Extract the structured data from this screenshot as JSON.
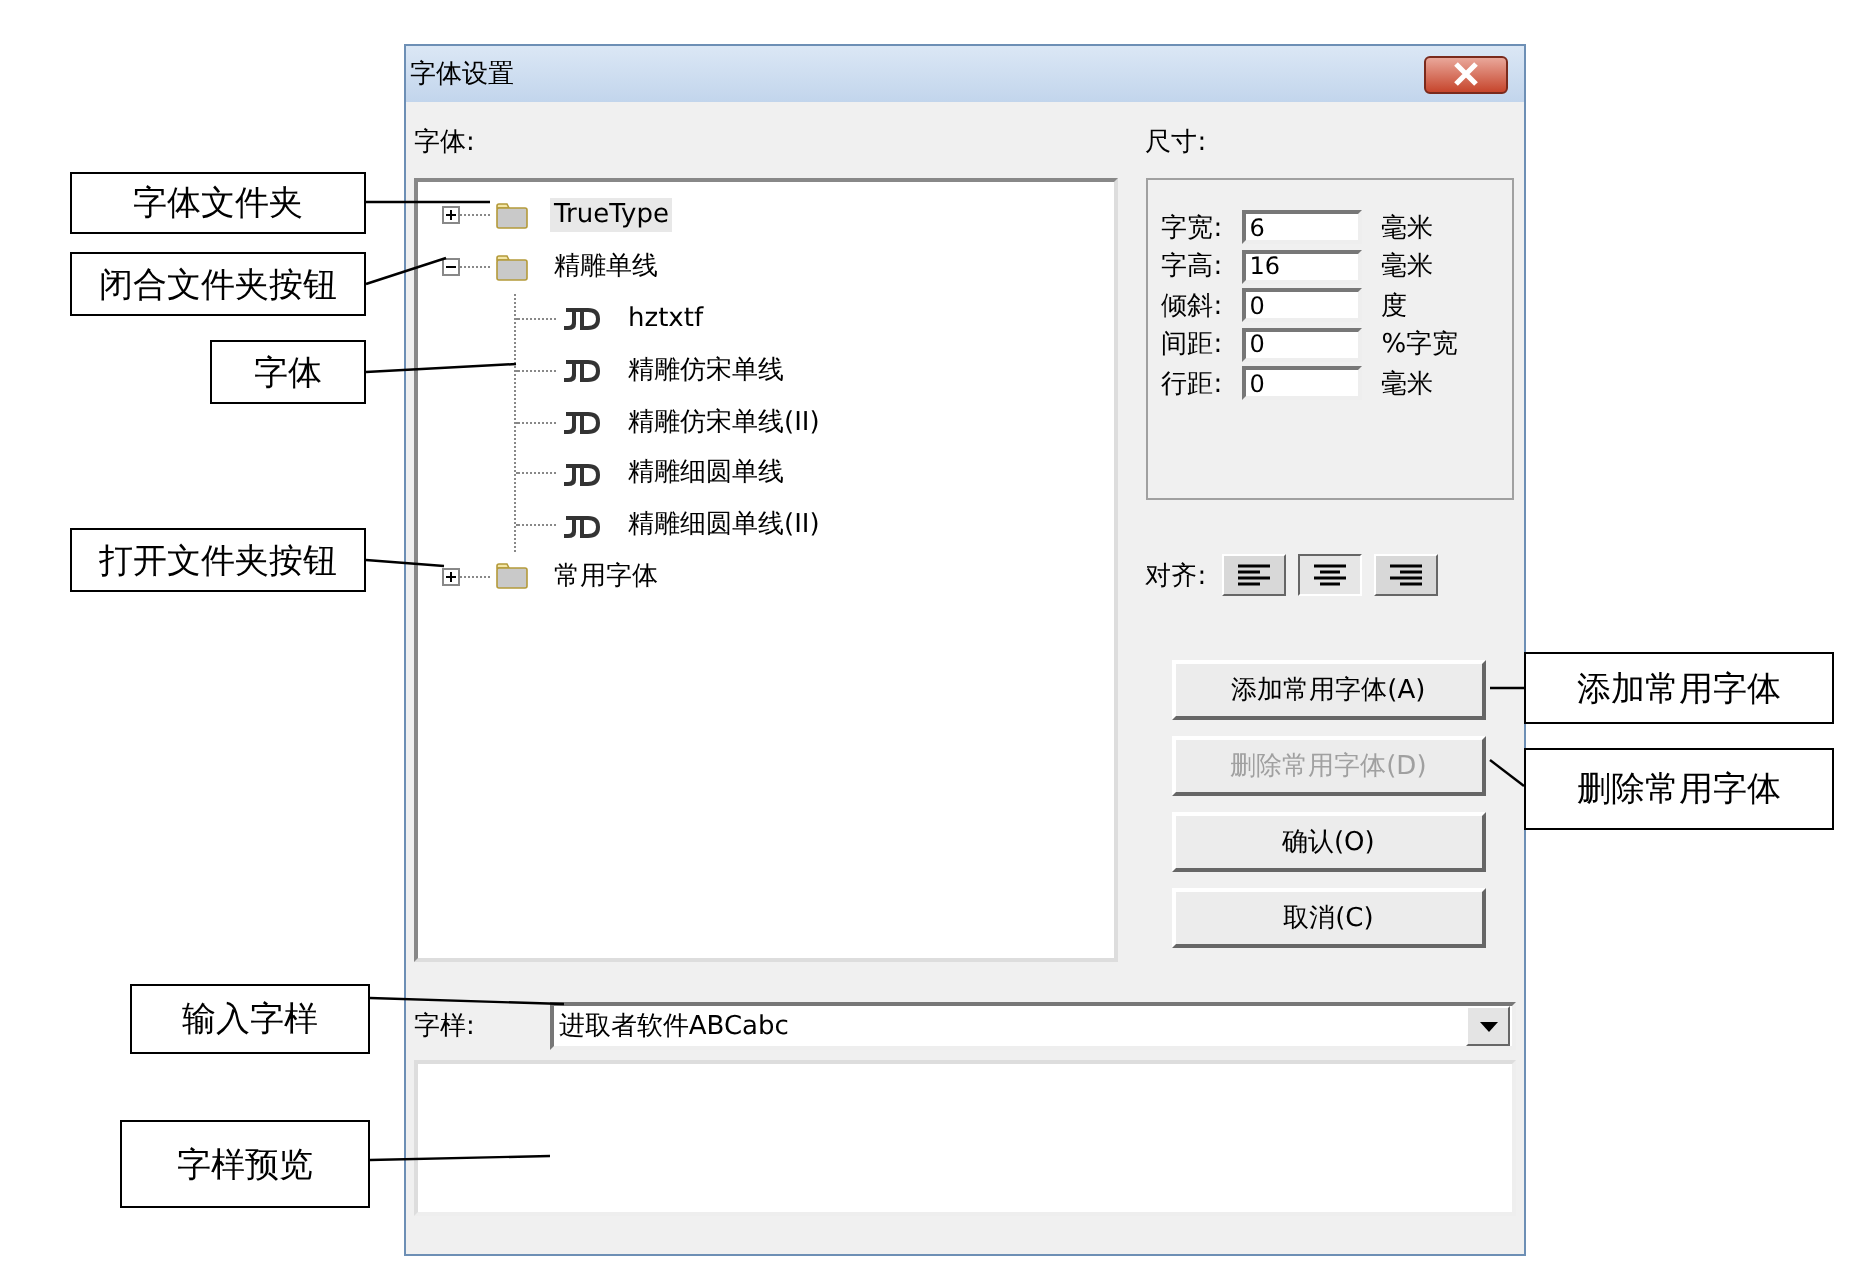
{
  "window": {
    "title": "字体设置"
  },
  "fonts": {
    "label": "字体:",
    "tree": [
      {
        "kind": "folder",
        "label": "TrueType",
        "expanded": false,
        "selected": true
      },
      {
        "kind": "folder",
        "label": "精雕单线",
        "expanded": true,
        "selected": false,
        "children": [
          {
            "kind": "font",
            "label": "hztxtf",
            "selected": false
          },
          {
            "kind": "font",
            "label": "精雕仿宋单线",
            "selected": false
          },
          {
            "kind": "font",
            "label": "精雕仿宋单线(II)",
            "selected": false
          },
          {
            "kind": "font",
            "label": "精雕细圆单线",
            "selected": false
          },
          {
            "kind": "font",
            "label": "精雕细圆单线(II)",
            "selected": false
          }
        ]
      },
      {
        "kind": "folder",
        "label": "常用字体",
        "expanded": false,
        "selected": false
      }
    ]
  },
  "size": {
    "label": "尺寸:",
    "fields": [
      {
        "label": "字宽:",
        "value": "6",
        "unit": "毫米"
      },
      {
        "label": "字高:",
        "value": "16",
        "unit": "毫米"
      },
      {
        "label": "倾斜:",
        "value": "0",
        "unit": "度"
      },
      {
        "label": "间距:",
        "value": "0",
        "unit": "%字宽"
      },
      {
        "label": "行距:",
        "value": "0",
        "unit": "毫米"
      }
    ]
  },
  "align": {
    "label": "对齐:",
    "options": [
      {
        "kind": "left",
        "selected": false
      },
      {
        "kind": "center",
        "selected": true
      },
      {
        "kind": "right",
        "selected": false
      }
    ]
  },
  "buttons": [
    {
      "label": "添加常用字体(A)",
      "disabled": false
    },
    {
      "label": "删除常用字体(D)",
      "disabled": true
    },
    {
      "label": "确认(O)",
      "disabled": false
    },
    {
      "label": "取消(C)",
      "disabled": false
    }
  ],
  "sample": {
    "label": "字样:",
    "value": "进取者软件ABCabc"
  },
  "callouts": [
    {
      "text": "字体文件夹"
    },
    {
      "text": "闭合文件夹按钮"
    },
    {
      "text": "字体"
    },
    {
      "text": "打开文件夹按钮"
    },
    {
      "text": "输入字样"
    },
    {
      "text": "字样预览"
    },
    {
      "text": "添加常用字体"
    },
    {
      "text": "删除常用字体"
    }
  ]
}
